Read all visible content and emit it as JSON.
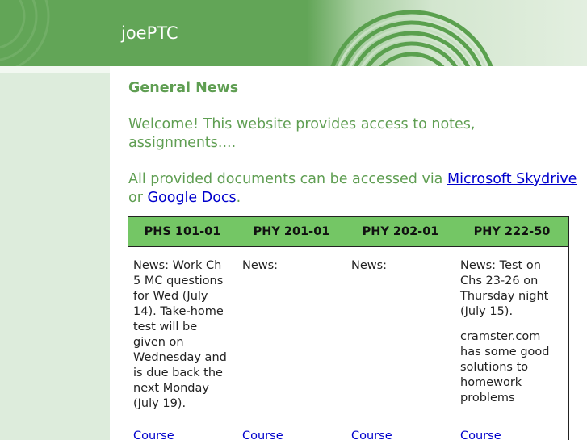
{
  "header": {
    "site_title": "joePTC"
  },
  "main": {
    "heading": "General News",
    "welcome_text": "Welcome! This website provides access to notes, assignments....",
    "access_prefix": "All provided documents can be accessed via ",
    "link_skydrive": "Microsoft Skydrive",
    "access_or": " or ",
    "link_google_docs": "Google Docs",
    "access_suffix": "."
  },
  "table": {
    "headers": [
      "PHS 101-01",
      "PHY 201-01",
      "PHY 202-01",
      "PHY 222-50"
    ],
    "news": [
      [
        "News: Work Ch 5 MC questions for Wed (July 14). Take-home test will be given on Wednesday and is due back the next Monday (July 19)."
      ],
      [
        "News:"
      ],
      [
        "News:"
      ],
      [
        "News: Test on Chs 23-26 on Thursday night (July 15).",
        "cramster.com has some good solutions to homework problems"
      ]
    ],
    "course_links": [
      "Course",
      "Course",
      "Course",
      "Course"
    ]
  },
  "colors": {
    "header_green": "#62a557",
    "table_header_green": "#74c665",
    "text_green": "#5f9e52",
    "sidebar": "#ddecdc",
    "link": "#0000cc"
  }
}
